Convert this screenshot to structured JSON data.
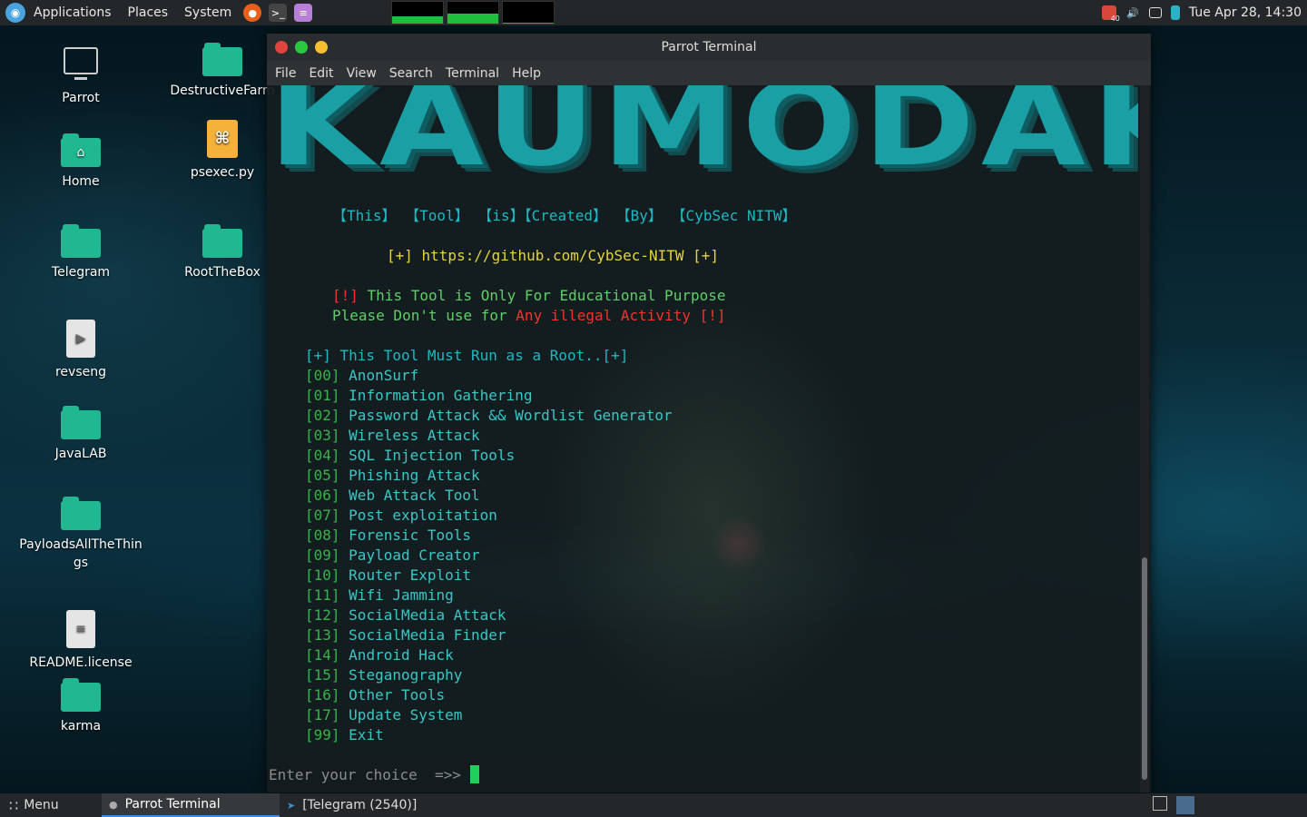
{
  "top_panel": {
    "applications": "Applications",
    "places": "Places",
    "system": "System",
    "clock": "Tue Apr 28, 14:30",
    "net_graph_level": 0.35,
    "cpu_graph_level": 0.45,
    "mem_graph_level": 0.05,
    "notification_badge": "40"
  },
  "desktop_icons": [
    {
      "label": "Parrot"
    },
    {
      "label": "Home"
    },
    {
      "label": "Telegram"
    },
    {
      "label": "revseng"
    },
    {
      "label": "JavaLAB"
    },
    {
      "label": "PayloadsAllTheThings"
    },
    {
      "label": "README.license"
    },
    {
      "label": "karma"
    },
    {
      "label": "DestructiveFarm"
    },
    {
      "label": "psexec.py"
    },
    {
      "label": "RootTheBox"
    }
  ],
  "terminal": {
    "title": "Parrot Terminal",
    "menu": [
      "File",
      "Edit",
      "View",
      "Search",
      "Terminal",
      "Help"
    ],
    "banner": "KAUMODAKI",
    "tagline": "【This】 【Tool】 【is】【Created】 【By】 【CybSec NITW】",
    "github_line": "[+] https://github.com/CybSec-NITW [+]",
    "warn_bang": "[!]",
    "warn_text": " This Tool is Only For Educational Purpose",
    "warn2_a": "Please Don't use for ",
    "warn2_b": "Any illegal Activity [!]",
    "root_line": "[+] This Tool Must Run as a Root..[+]",
    "items": [
      {
        "num": "[00]",
        "label": "AnonSurf"
      },
      {
        "num": "[01]",
        "label": "Information Gathering"
      },
      {
        "num": "[02]",
        "label": "Password Attack && Wordlist Generator"
      },
      {
        "num": "[03]",
        "label": "Wireless Attack"
      },
      {
        "num": "[04]",
        "label": "SQL Injection Tools"
      },
      {
        "num": "[05]",
        "label": "Phishing Attack"
      },
      {
        "num": "[06]",
        "label": "Web Attack Tool"
      },
      {
        "num": "[07]",
        "label": "Post exploitation"
      },
      {
        "num": "[08]",
        "label": "Forensic Tools"
      },
      {
        "num": "[09]",
        "label": "Payload Creator"
      },
      {
        "num": "[10]",
        "label": "Router Exploit"
      },
      {
        "num": "[11]",
        "label": "Wifi Jamming"
      },
      {
        "num": "[12]",
        "label": "SocialMedia Attack"
      },
      {
        "num": "[13]",
        "label": "SocialMedia Finder"
      },
      {
        "num": "[14]",
        "label": "Android Hack"
      },
      {
        "num": "[15]",
        "label": "Steganography"
      },
      {
        "num": "[16]",
        "label": "Other Tools"
      },
      {
        "num": "[17]",
        "label": "Update System"
      },
      {
        "num": "[99]",
        "label": "Exit"
      }
    ],
    "prompt": "Enter your choice  =>> "
  },
  "bottom_panel": {
    "menu": "Menu",
    "tasks": [
      "Parrot Terminal",
      "[Telegram (2540)]"
    ]
  }
}
